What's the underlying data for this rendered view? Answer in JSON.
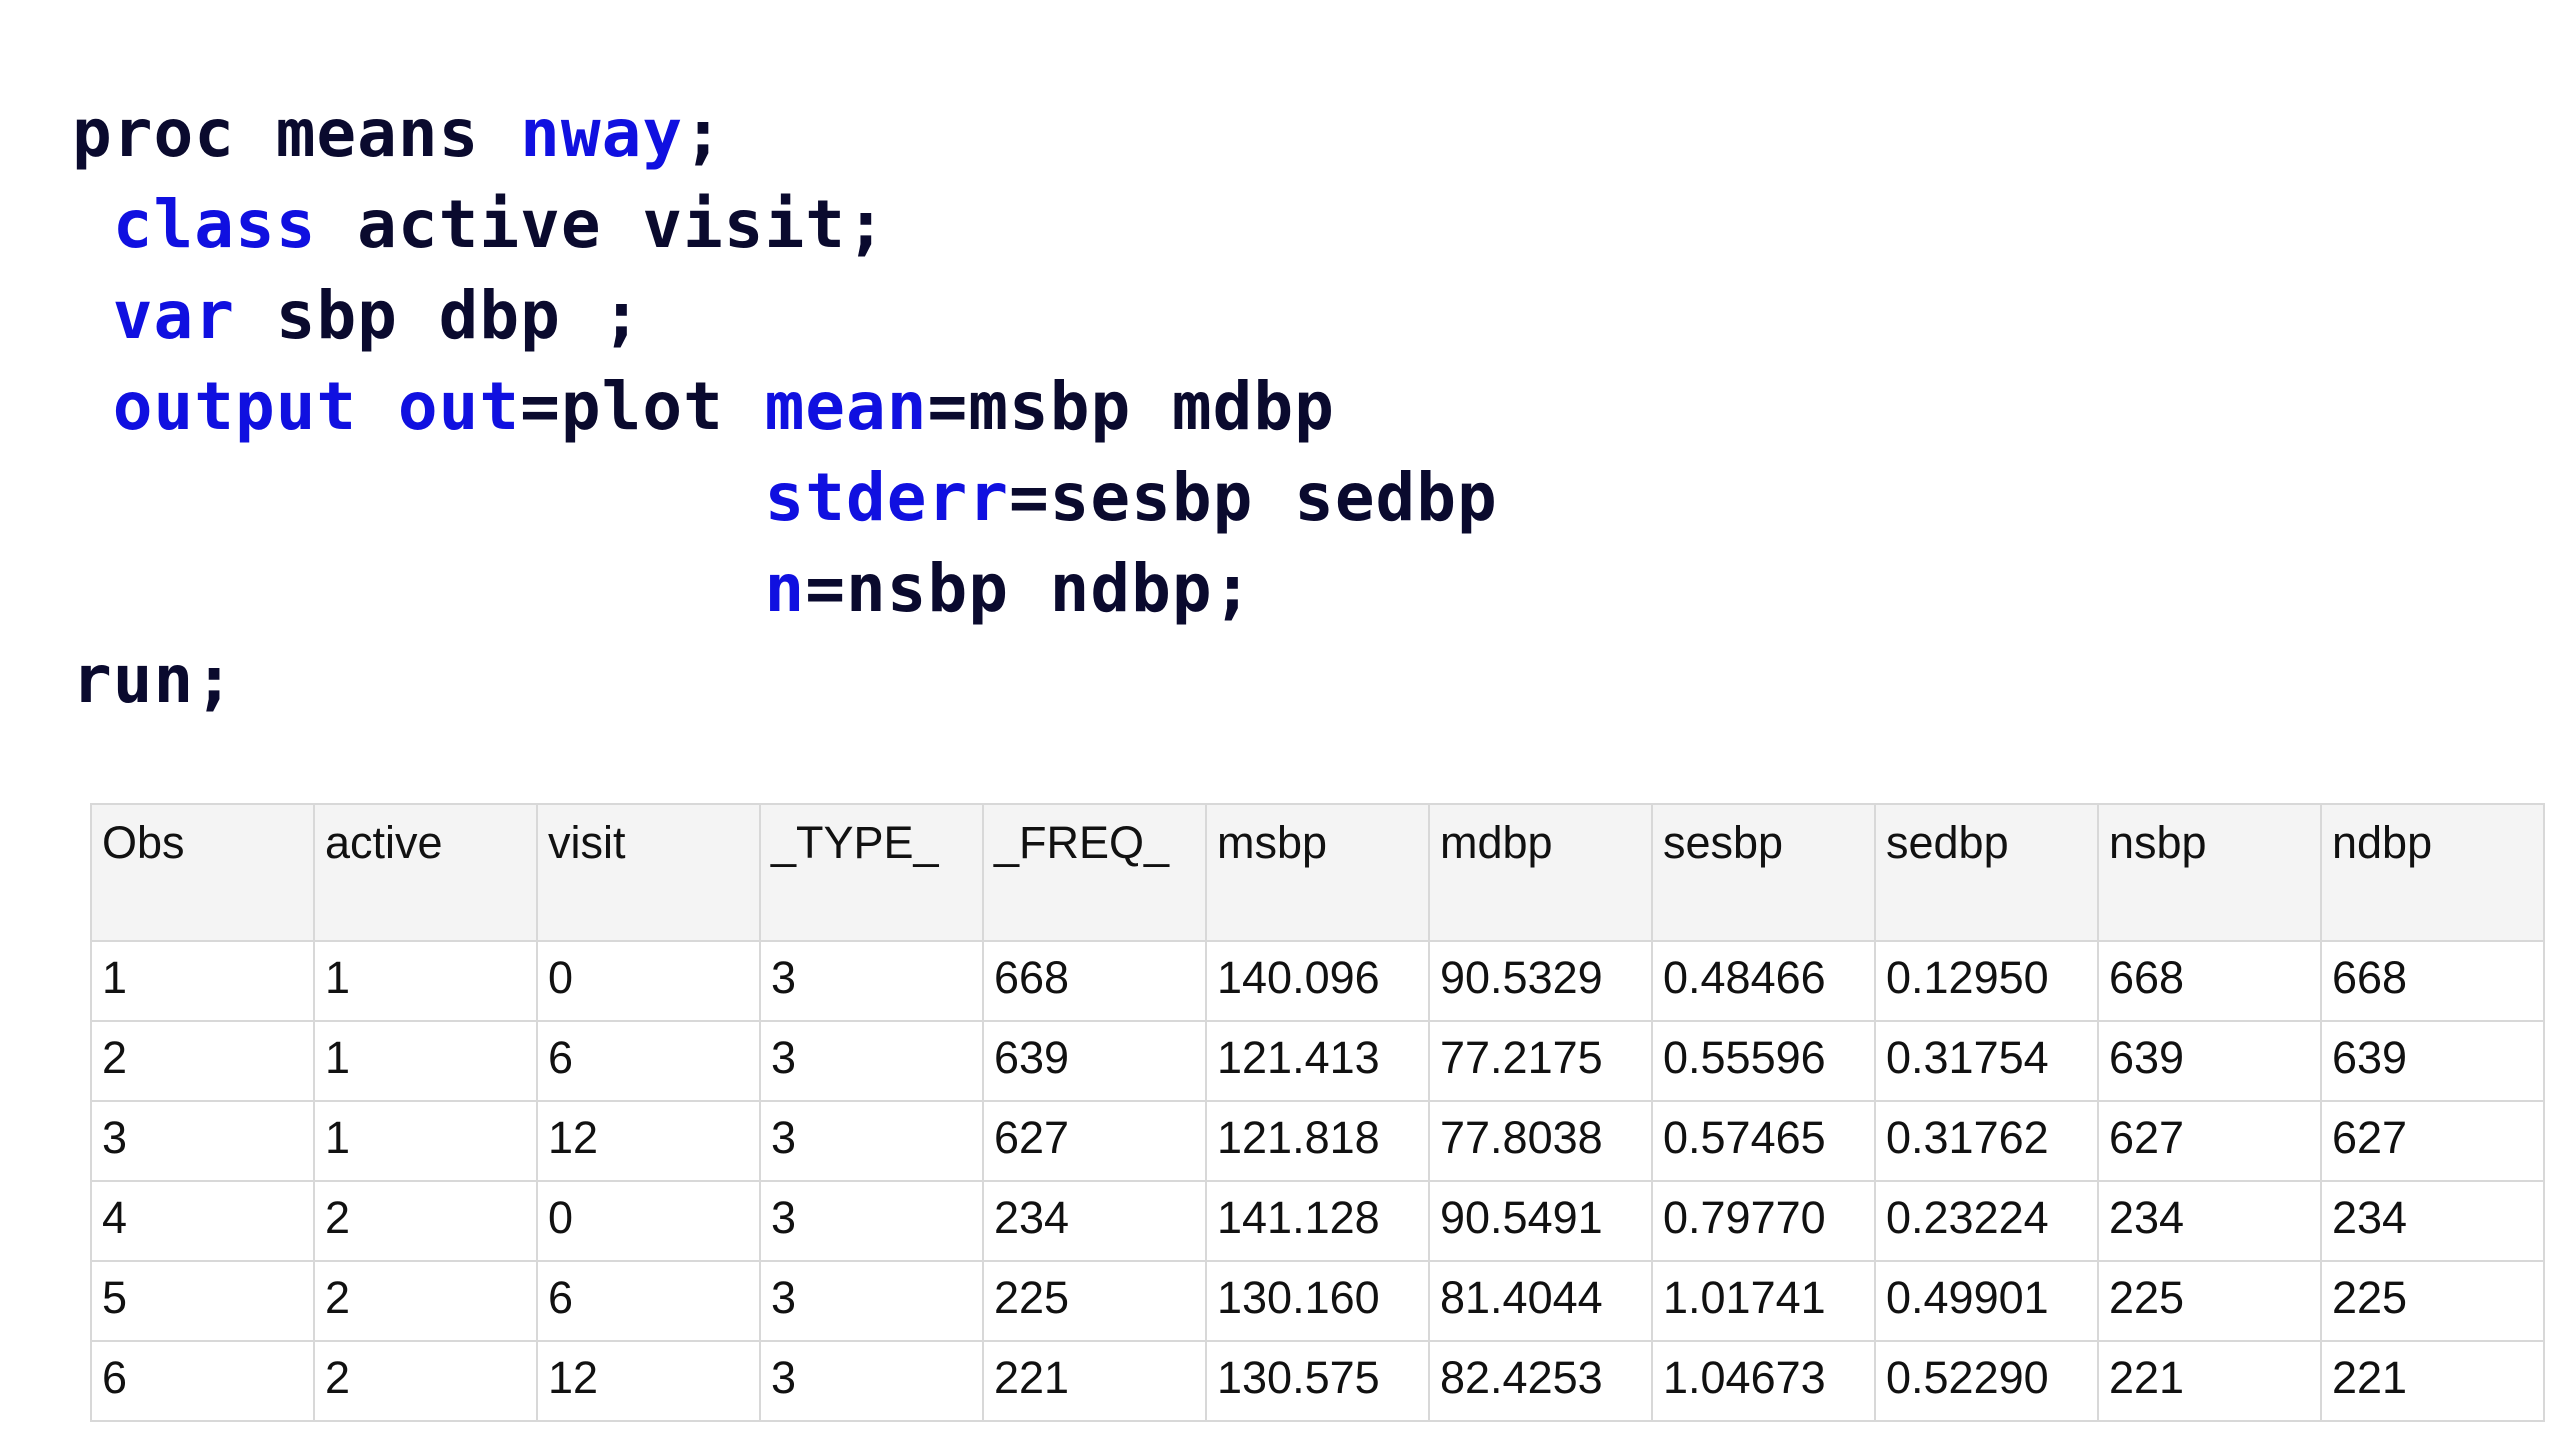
{
  "code": {
    "lines": [
      [
        {
          "t": "proc ",
          "k": "base"
        },
        {
          "t": "means ",
          "k": "base"
        },
        {
          "t": "nway",
          "k": "kw"
        },
        {
          "t": ";",
          "k": "base"
        }
      ],
      [
        {
          "t": " ",
          "k": "base"
        },
        {
          "t": "class",
          "k": "kw"
        },
        {
          "t": " active visit;",
          "k": "base"
        }
      ],
      [
        {
          "t": " ",
          "k": "base"
        },
        {
          "t": "var",
          "k": "kw"
        },
        {
          "t": " sbp dbp ;",
          "k": "base"
        }
      ],
      [
        {
          "t": " ",
          "k": "base"
        },
        {
          "t": "output",
          "k": "kw"
        },
        {
          "t": " ",
          "k": "base"
        },
        {
          "t": "out",
          "k": "kw"
        },
        {
          "t": "=plot ",
          "k": "base"
        },
        {
          "t": "mean",
          "k": "kw"
        },
        {
          "t": "=msbp mdbp",
          "k": "base"
        }
      ],
      [
        {
          "t": "                 ",
          "k": "base"
        },
        {
          "t": "stderr",
          "k": "kw"
        },
        {
          "t": "=sesbp sedbp",
          "k": "base"
        }
      ],
      [
        {
          "t": "                 ",
          "k": "base"
        },
        {
          "t": "n",
          "k": "kw"
        },
        {
          "t": "=nsbp ndbp;",
          "k": "base"
        }
      ],
      [
        {
          "t": "run",
          "k": "base"
        },
        {
          "t": ";",
          "k": "base"
        }
      ]
    ]
  },
  "table": {
    "headers": [
      "Obs",
      "active",
      "visit",
      "_TYPE_",
      "_FREQ_",
      "msbp",
      "mdbp",
      "sesbp",
      "sedbp",
      "nsbp",
      "ndbp"
    ],
    "rows": [
      [
        "1",
        "1",
        "0",
        "3",
        "668",
        "140.096",
        "90.5329",
        "0.48466",
        "0.12950",
        "668",
        "668"
      ],
      [
        "2",
        "1",
        "6",
        "3",
        "639",
        "121.413",
        "77.2175",
        "0.55596",
        "0.31754",
        "639",
        "639"
      ],
      [
        "3",
        "1",
        "12",
        "3",
        "627",
        "121.818",
        "77.8038",
        "0.57465",
        "0.31762",
        "627",
        "627"
      ],
      [
        "4",
        "2",
        "0",
        "3",
        "234",
        "141.128",
        "90.5491",
        "0.79770",
        "0.23224",
        "234",
        "234"
      ],
      [
        "5",
        "2",
        "6",
        "3",
        "225",
        "130.160",
        "81.4044",
        "1.01741",
        "0.49901",
        "225",
        "225"
      ],
      [
        "6",
        "2",
        "12",
        "3",
        "221",
        "130.575",
        "82.4253",
        "1.04673",
        "0.52290",
        "221",
        "221"
      ]
    ]
  }
}
